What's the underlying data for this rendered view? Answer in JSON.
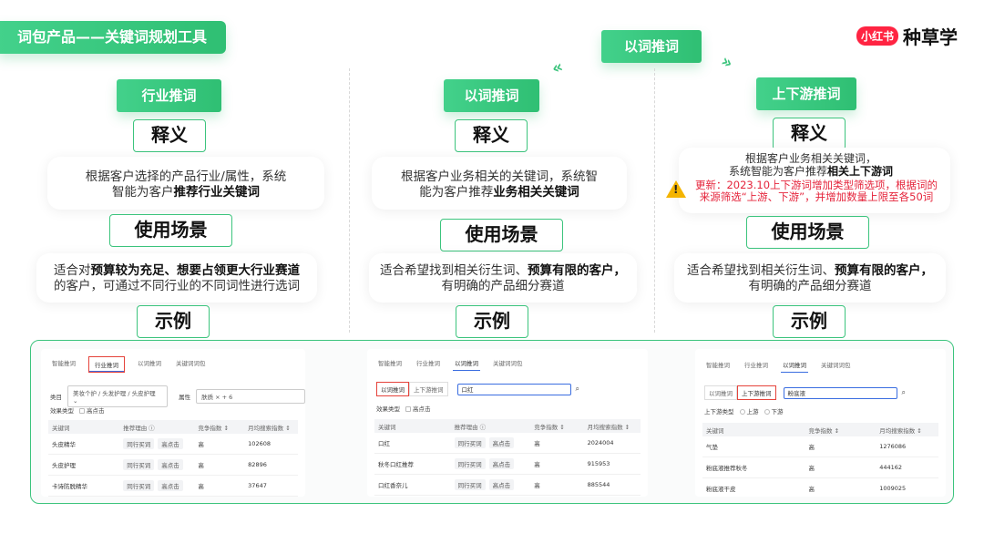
{
  "header": {
    "title": "词包产品——关键词规划工具",
    "logo_mark": "小红书",
    "logo_text": "种草学",
    "brand_color": "#ff2442",
    "accent_color": "#3cc47d"
  },
  "top_badge": {
    "label": "以词推词"
  },
  "columns": [
    {
      "tag": "行业推词",
      "meaning_title": "释义",
      "meaning_line1": "根据客户选择的产品行业/属性，系统",
      "meaning_line2_plain": "智能为客户",
      "meaning_line2_bold": "推荐行业关键词",
      "scene_title": "使用场景",
      "scene_line1_plain": "适合对",
      "scene_line1_bold": "预算较为充足、想要占领更大行业赛道",
      "scene_line2": "的客户，可通过不同行业的不同词性进行选词",
      "example_title": "示例"
    },
    {
      "tag": "以词推词",
      "meaning_title": "释义",
      "meaning_line1": "根据客户业务相关的关键词，系统智",
      "meaning_line2_plain": "能为客户推荐",
      "meaning_line2_bold": "业务相关关键词",
      "scene_title": "使用场景",
      "scene_line1_plain": "适合希望找到相关衍生词、",
      "scene_line1_bold": "预算有限的客户，",
      "scene_line2": "有明确的产品细分赛道",
      "example_title": "示例"
    },
    {
      "tag": "上下游推词",
      "meaning_title": "释义",
      "meaning_line1": "根据客户业务相关关键词，",
      "meaning_line2_plain": "系统智能为客户推荐",
      "meaning_line2_bold": "相关上下游词",
      "update_line1": "更新：2023.10上下游词增加类型筛选项，根据词的",
      "update_line2": "来源筛选“上游、下游”，并增加数量上限至各50词",
      "scene_title": "使用场景",
      "scene_line1_plain": "适合希望找到相关衍生词、",
      "scene_line1_bold": "预算有限的客户，",
      "scene_line2": "有明确的产品细分赛道",
      "example_title": "示例"
    }
  ],
  "mock1": {
    "tabs": [
      "智能推词",
      "行业推词",
      "以词推词",
      "关键词词包"
    ],
    "category_label": "类目",
    "category_value": "美妆个护 / 头发护理 / 头皮护理",
    "attr_label": "属性",
    "attr_value": "肤质 × + 6",
    "effect_label": "效果类型",
    "effect_option": "高点击",
    "columns": [
      "关键词",
      "推荐理由 ⓘ",
      "竞争指数 ↕",
      "月均搜索指数 ↕"
    ],
    "rows": [
      {
        "kw": "头皮精华",
        "tags": [
          "同行买词",
          "高点击"
        ],
        "comp": "高",
        "search": "102608"
      },
      {
        "kw": "头皮护理",
        "tags": [
          "同行买词",
          "高点击"
        ],
        "comp": "高",
        "search": "82896"
      },
      {
        "kw": "卡诗防脱精华",
        "tags": [
          "同行买词",
          "高点击"
        ],
        "comp": "高",
        "search": "37647"
      }
    ]
  },
  "mock2": {
    "tabs": [
      "智能推词",
      "行业推词",
      "以词推词",
      "关键词词包"
    ],
    "btn_a": "以词推词",
    "btn_b": "上下游推词",
    "search_value": "口红",
    "effect_label": "效果类型",
    "effect_option": "高点击",
    "columns": [
      "关键词",
      "推荐理由 ⓘ",
      "竞争指数 ↕",
      "月均搜索指数 ↕"
    ],
    "rows": [
      {
        "kw": "口红",
        "tags": [
          "同行买词",
          "高点击"
        ],
        "comp": "高",
        "search": "2024004"
      },
      {
        "kw": "秋冬口红推荐",
        "tags": [
          "同行买词",
          "高点击"
        ],
        "comp": "高",
        "search": "915953"
      },
      {
        "kw": "口红香奈儿",
        "tags": [
          "同行买词",
          "高点击"
        ],
        "comp": "高",
        "search": "885544"
      }
    ]
  },
  "mock3": {
    "tabs": [
      "智能推词",
      "行业推词",
      "以词推词",
      "关键词词包"
    ],
    "btn_a": "以词推词",
    "btn_b": "上下游推词",
    "search_value": "粉底液",
    "filter_label": "上下游类型",
    "opt_up": "上游",
    "opt_down": "下游",
    "columns": [
      "关键词",
      "竞争指数 ↕",
      "月均搜索指数 ↕"
    ],
    "rows": [
      {
        "kw": "气垫",
        "comp": "高",
        "search": "1276086"
      },
      {
        "kw": "粉底液推荐秋冬",
        "comp": "高",
        "search": "444162"
      },
      {
        "kw": "粉底液干皮",
        "comp": "高",
        "search": "1009025"
      }
    ]
  }
}
